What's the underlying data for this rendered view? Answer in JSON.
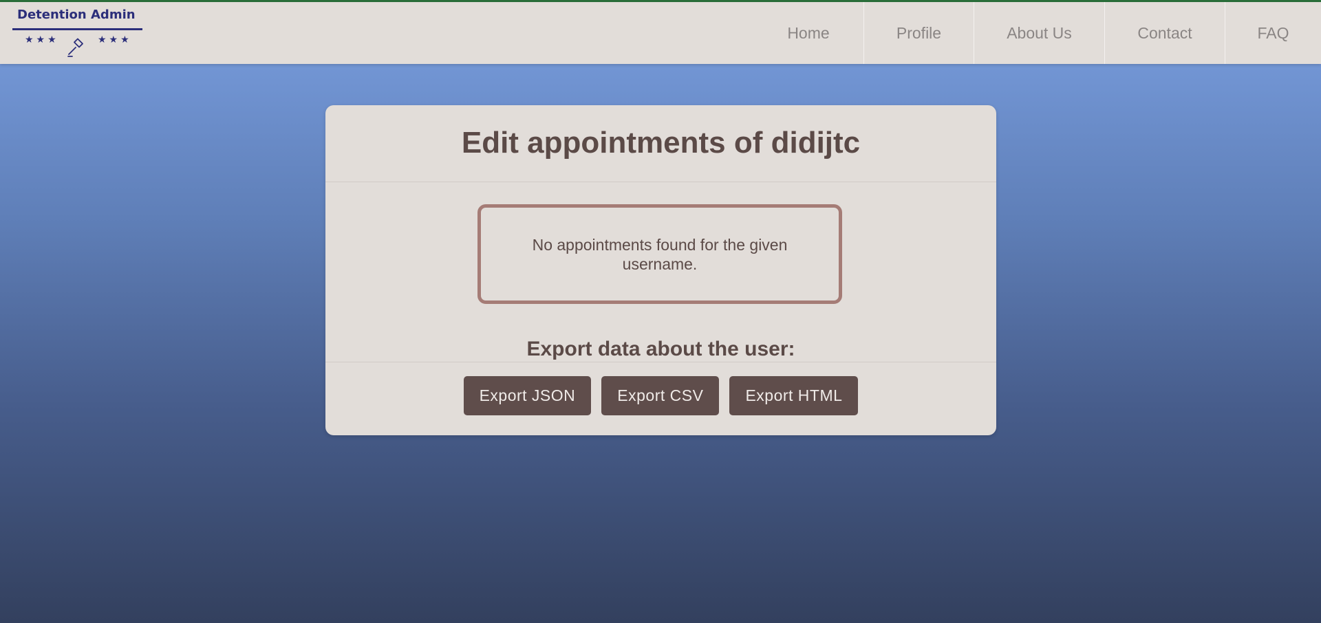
{
  "header": {
    "logo": {
      "title": "Detention Admin",
      "stars_left": "★★★",
      "stars_right": "★★★",
      "icon": "gavel-icon"
    },
    "nav": [
      {
        "label": "Home"
      },
      {
        "label": "Profile"
      },
      {
        "label": "About Us"
      },
      {
        "label": "Contact"
      },
      {
        "label": "FAQ"
      }
    ]
  },
  "main": {
    "title": "Edit appointments of didijtc",
    "notice": "No appointments found for the given username.",
    "export_heading": "Export data about the user:",
    "export_buttons": [
      {
        "label": "Export JSON"
      },
      {
        "label": "Export CSV"
      },
      {
        "label": "Export HTML"
      }
    ]
  },
  "colors": {
    "brand": "#2b2e7a",
    "accent_top": "#2a6e3a",
    "button": "#5f4d4b",
    "notice_border": "#a57c76",
    "text": "#5b4a47",
    "panel": "#e2ddd9"
  }
}
